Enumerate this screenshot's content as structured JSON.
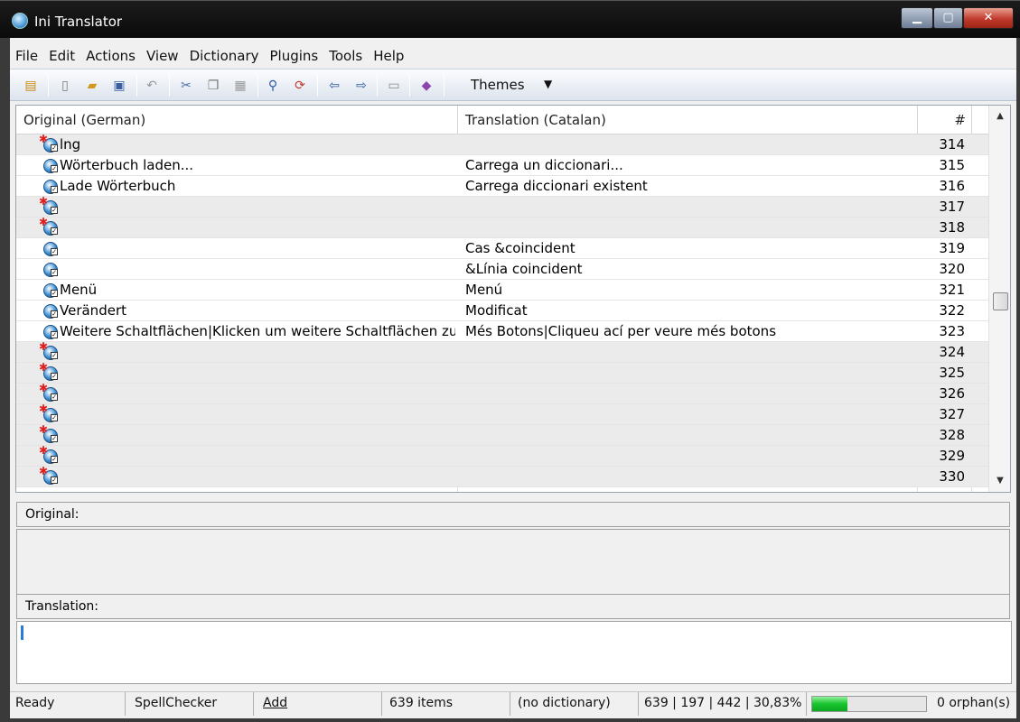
{
  "window": {
    "title": "Ini Translator",
    "min": "▁",
    "max": "▢",
    "close": "✕"
  },
  "menu": [
    "File",
    "Edit",
    "Actions",
    "View",
    "Dictionary",
    "Plugins",
    "Tools",
    "Help"
  ],
  "toolbar": {
    "themes_label": "Themes",
    "themes_arrow": "▼"
  },
  "grid": {
    "columns": {
      "original": "Original (German)",
      "translation": "Translation (Catalan)",
      "number": "#"
    },
    "rows": [
      {
        "original": "lng",
        "translation": "",
        "num": "314",
        "state": "untranslated"
      },
      {
        "original": "Wörterbuch laden...",
        "translation": "Carrega un diccionari...",
        "num": "315",
        "state": "translated"
      },
      {
        "original": "Lade Wörterbuch",
        "translation": "Carrega diccionari existent",
        "num": "316",
        "state": "translated"
      },
      {
        "original": "",
        "translation": "",
        "num": "317",
        "state": "untranslated"
      },
      {
        "original": "",
        "translation": "",
        "num": "318",
        "state": "untranslated"
      },
      {
        "original": "",
        "translation": "Cas &coincident",
        "num": "319",
        "state": "translated"
      },
      {
        "original": "",
        "translation": "&Línia coincident",
        "num": "320",
        "state": "translated"
      },
      {
        "original": "Menü",
        "translation": "Menú",
        "num": "321",
        "state": "translated"
      },
      {
        "original": "Verändert",
        "translation": "Modificat",
        "num": "322",
        "state": "translated"
      },
      {
        "original": "Weitere Schaltflächen|Klicken um weitere Schaltflächen zu ...",
        "translation": "Més Botons|Cliqueu ací per veure més botons",
        "num": "323",
        "state": "translated"
      },
      {
        "original": "",
        "translation": "",
        "num": "324",
        "state": "untranslated"
      },
      {
        "original": "",
        "translation": "",
        "num": "325",
        "state": "untranslated"
      },
      {
        "original": "",
        "translation": "",
        "num": "326",
        "state": "untranslated"
      },
      {
        "original": "",
        "translation": "",
        "num": "327",
        "state": "untranslated"
      },
      {
        "original": "",
        "translation": "",
        "num": "328",
        "state": "untranslated"
      },
      {
        "original": "",
        "translation": "",
        "num": "329",
        "state": "untranslated"
      },
      {
        "original": "",
        "translation": "",
        "num": "330",
        "state": "untranslated"
      }
    ]
  },
  "panels": {
    "original_label": "Original:",
    "translation_label": "Translation:"
  },
  "status": {
    "ready": "Ready",
    "spellchecker": "SpellChecker",
    "add": "Add",
    "items": "639 items",
    "dictionary": "(no dictionary)",
    "stats": "639 | 197 | 442 | 30,83%",
    "progress": 0.3083,
    "orphans": "0 orphan(s)"
  },
  "colors": {
    "progress_green": "#17c32e",
    "untranslated_row": "#ebebeb"
  }
}
